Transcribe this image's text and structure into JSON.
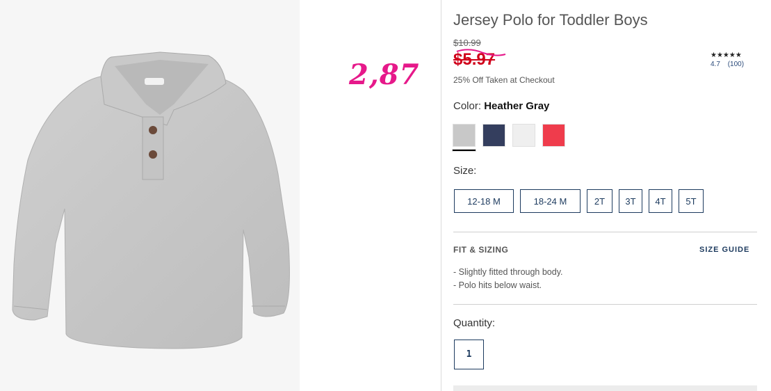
{
  "product": {
    "title": "Jersey Polo for Toddler Boys",
    "original_price": "$10.99",
    "sale_price": "$5.97",
    "discount_note": "25% Off Taken at Checkout",
    "rating": {
      "stars": "★★★★★",
      "score": "4.7",
      "count": "(100)"
    },
    "image_icon": "shirt-image"
  },
  "annotation": {
    "handwritten_price": "2,87",
    "color": "#e6198a"
  },
  "color": {
    "label": "Color:",
    "selected": "Heather Gray",
    "swatches": [
      {
        "name": "heather-gray",
        "hex": "#c8c8c8"
      },
      {
        "name": "navy",
        "hex": "#343e5e"
      },
      {
        "name": "white",
        "hex": "#efefef"
      },
      {
        "name": "red",
        "hex": "#ef3c4c"
      }
    ]
  },
  "size": {
    "label": "Size:",
    "options": [
      "12-18 M",
      "18-24 M",
      "2T",
      "3T",
      "4T",
      "5T"
    ]
  },
  "fit": {
    "title": "FIT & SIZING",
    "size_guide": "SIZE GUIDE",
    "bullets": [
      "-  Slightly fitted through body.",
      "-  Polo hits below waist."
    ]
  },
  "quantity": {
    "label": "Quantity:",
    "value": "1"
  },
  "colors": {
    "sale": "#d0021b",
    "navy": "#1c3a5e"
  }
}
